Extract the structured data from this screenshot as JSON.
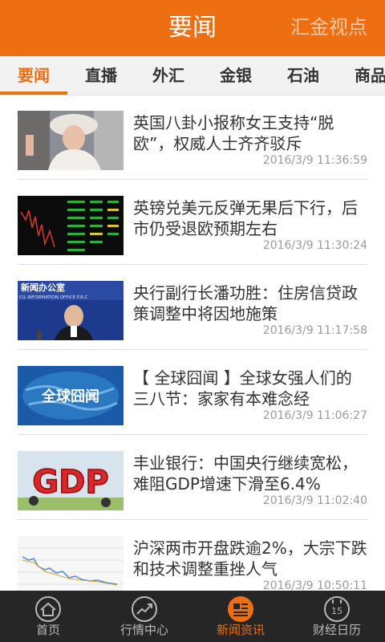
{
  "header": {
    "title": "要闻",
    "right_link": "汇金视点"
  },
  "tabs": [
    {
      "label": "要闻",
      "active": true
    },
    {
      "label": "直播"
    },
    {
      "label": "外汇"
    },
    {
      "label": "金银"
    },
    {
      "label": "石油"
    },
    {
      "label": "商品"
    }
  ],
  "news": [
    {
      "title": "英国八卦小报称女王支持“脱欧”，权威人士齐齐驳斥",
      "time": "2016/3/9 11:36:59",
      "thumb": "queen-photo"
    },
    {
      "title": "英镑兑美元反弹无果后下行，后市仍受退欧预期左右",
      "time": "2016/3/9 11:30:24",
      "thumb": "trading-screen"
    },
    {
      "title": "央行副行长潘功胜：住房信贷政策调整中将因地施策",
      "time": "2016/3/9 11:17:58",
      "thumb": "press-conference",
      "thumb_text_1": "新闻办公室",
      "thumb_text_2": "CIL INFORMATION OFFICE P.R.C"
    },
    {
      "title": "【 全球囧闻 】全球女强人们的三八节：家家有本难念经",
      "time": "2016/3/9 11:06:27",
      "thumb": "globe-logo",
      "thumb_text": "全球囧闻"
    },
    {
      "title": "丰业银行：中国央行继续宽松，难阻GDP增速下滑至6.4%",
      "time": "2016/3/9 11:02:40",
      "thumb": "gdp-cartoon",
      "thumb_text": "GDP"
    },
    {
      "title": "沪深两市开盘跌逾2%，大宗下跌和技术调整重挫人气",
      "time": "2016/3/9 10:50:11",
      "thumb": "stock-chart"
    }
  ],
  "tabbar": [
    {
      "label": "首页",
      "icon": "home-icon"
    },
    {
      "label": "行情中心",
      "icon": "market-chart-icon"
    },
    {
      "label": "新闻资讯",
      "icon": "news-icon",
      "active": true
    },
    {
      "label": "财经日历",
      "icon": "calendar-icon",
      "day": "15"
    }
  ],
  "colors": {
    "accent": "#ee6f12",
    "tabbar_bg": "#262626",
    "header_bg": "#ee6f12"
  }
}
